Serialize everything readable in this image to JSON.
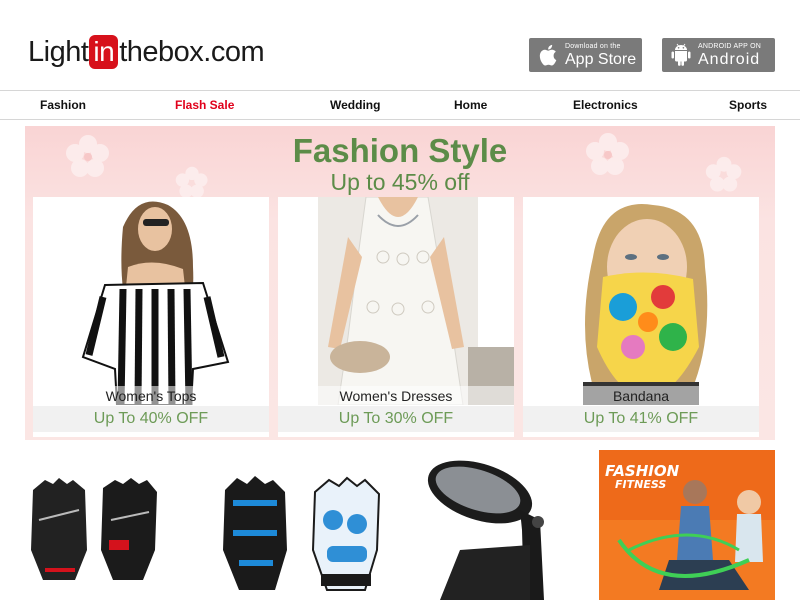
{
  "header": {
    "logo_pre": "Light",
    "logo_in": "in",
    "logo_post": "thebox.com",
    "app_store": {
      "small": "Download on the",
      "big": "App Store"
    },
    "android": {
      "small": "ANDROID APP ON",
      "big": "Android"
    }
  },
  "nav": [
    {
      "label": "Fashion"
    },
    {
      "label": "Flash Sale"
    },
    {
      "label": "Wedding"
    },
    {
      "label": "Home"
    },
    {
      "label": "Electronics"
    },
    {
      "label": "Sports"
    }
  ],
  "banner": {
    "title": "Fashion Style",
    "subtitle": "Up to 45% off",
    "cards": [
      {
        "name": "Women's Tops",
        "offer": "Up To 40% OFF"
      },
      {
        "name": "Women's Dresses",
        "offer": "Up To 30% OFF"
      },
      {
        "name": "Bandana",
        "offer": "Up To 41% OFF"
      }
    ]
  },
  "products": {
    "fitness_title_a": "FASHION",
    "fitness_title_b": "FITNESS"
  },
  "colors": {
    "brand_red": "#d7111b",
    "flash_red": "#e0001b",
    "banner_green": "#5c8c48",
    "offer_green": "#6d9b57",
    "store_button_gray": "#7a7a7a"
  }
}
